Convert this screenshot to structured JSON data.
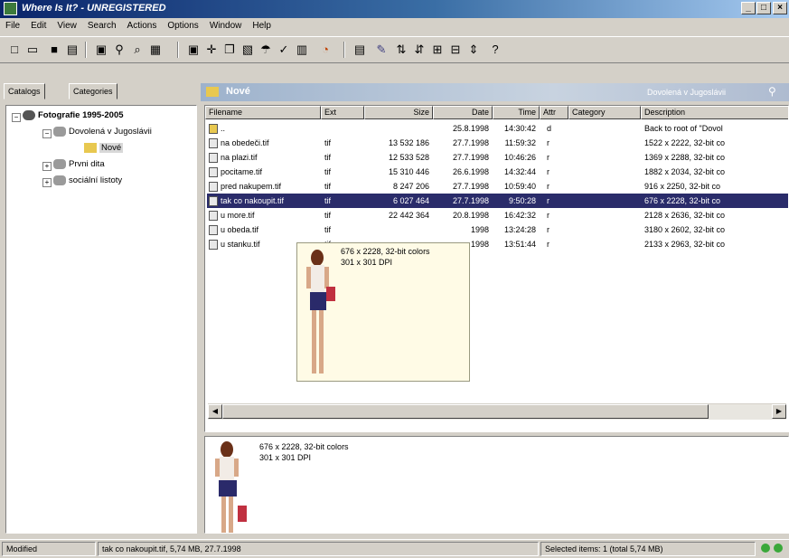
{
  "window": {
    "title": "Where Is It? - UNREGISTERED"
  },
  "menu": [
    "File",
    "Edit",
    "View",
    "Search",
    "Actions",
    "Options",
    "Window",
    "Help"
  ],
  "toolbar_icons": [
    "new-icon",
    "open-icon",
    "save-icon",
    "print-icon",
    "catalog-icon",
    "find-icon",
    "scan-icon",
    "update-icon",
    "add-icon",
    "move-icon",
    "copy-icon",
    "delete-icon",
    "check-icon",
    "tools-icon",
    "color-icon",
    "view-icon",
    "edit-icon",
    "sort-az-icon",
    "sort-za-icon",
    "sort-date-icon",
    "filter-icon",
    "columns-icon",
    "help-icon"
  ],
  "tabs": [
    "Catalogs",
    "Categories"
  ],
  "tree": [
    {
      "label": "Fotografie 1995-2005",
      "level": 0,
      "expander": "−"
    },
    {
      "label": "Dovolená v Jugoslávii",
      "level": 1,
      "expander": "−"
    },
    {
      "label": "Nové",
      "level": 2,
      "expander": ""
    },
    {
      "label": "Prvni dita",
      "level": 1,
      "expander": "+"
    },
    {
      "label": "sociální listoty",
      "level": 1,
      "expander": "+"
    }
  ],
  "folder": {
    "name": "Nové",
    "search_label": "Dovolená v Jugoslávii"
  },
  "columns": [
    "Filename",
    "Ext",
    "Size",
    "Date",
    "Time",
    "Attr",
    "Category",
    "Description"
  ],
  "rows": [
    {
      "name": "..",
      "ext": "",
      "size": "",
      "date": "25.8.1998",
      "time": "14:30:42",
      "attr": "d",
      "cat": "",
      "desc": "Back to root of \"Dovol"
    },
    {
      "name": "na obedeči.tif",
      "ext": "tif",
      "size": "13 532 186",
      "date": "27.7.1998",
      "time": "11:59:32",
      "attr": "r",
      "cat": "",
      "desc": "1522 x 2222, 32-bit co"
    },
    {
      "name": "na plazi.tif",
      "ext": "tif",
      "size": "12 533 528",
      "date": "27.7.1998",
      "time": "10:46:26",
      "attr": "r",
      "cat": "",
      "desc": "1369 x 2288, 32-bit co"
    },
    {
      "name": "pocitame.tif",
      "ext": "tif",
      "size": "15 310 446",
      "date": "26.6.1998",
      "time": "14:32:44",
      "attr": "r",
      "cat": "",
      "desc": "1882 x 2034, 32-bit co"
    },
    {
      "name": "pred nakupem.tif",
      "ext": "tif",
      "size": "8 247 206",
      "date": "27.7.1998",
      "time": "10:59:40",
      "attr": "r",
      "cat": "",
      "desc": "916 x 2250, 32-bit co"
    },
    {
      "name": "tak co nakoupit.tif",
      "ext": "tif",
      "size": "6 027 464",
      "date": "27.7.1998",
      "time": "9:50:28",
      "attr": "r",
      "cat": "",
      "desc": "676 x 2228, 32-bit co",
      "selected": true
    },
    {
      "name": "u more.tif",
      "ext": "tif",
      "size": "22 442 364",
      "date": "20.8.1998",
      "time": "16:42:32",
      "attr": "r",
      "cat": "",
      "desc": "2128 x 2636, 32-bit co"
    },
    {
      "name": "u obeda.tif",
      "ext": "tif",
      "size": "",
      "date": "1998",
      "time": "13:24:28",
      "attr": "r",
      "cat": "",
      "desc": "3180 x 2602, 32-bit co"
    },
    {
      "name": "u stanku.tif",
      "ext": "tif",
      "size": "",
      "date": "1998",
      "time": "13:51:44",
      "attr": "r",
      "cat": "",
      "desc": "2133 x 2963, 32-bit co"
    }
  ],
  "tooltip": {
    "line1": "676 x 2228, 32-bit colors",
    "line2": "301 x 301 DPI"
  },
  "preview": {
    "line1": "676 x 2228, 32-bit colors",
    "line2": "301 x 301 DPI"
  },
  "status": {
    "state": "Modified",
    "file": "tak co nakoupit.tif, 5,74 MB, 27.7.1998",
    "selection": "Selected items: 1 (total 5,74 MB)"
  }
}
